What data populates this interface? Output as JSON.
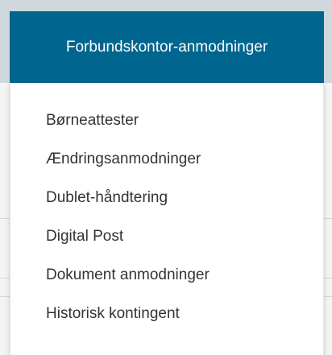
{
  "nav": {
    "button_label": "Forbundskontor-anmodninger"
  },
  "menu": {
    "items": [
      {
        "label": "Børneattester"
      },
      {
        "label": "Ændringsanmodninger"
      },
      {
        "label": "Dublet-håndtering"
      },
      {
        "label": "Digital Post"
      },
      {
        "label": "Dokument anmodninger"
      },
      {
        "label": "Historisk kontingent"
      }
    ]
  },
  "colors": {
    "accent": "#00668f",
    "menu_text": "#333333"
  }
}
